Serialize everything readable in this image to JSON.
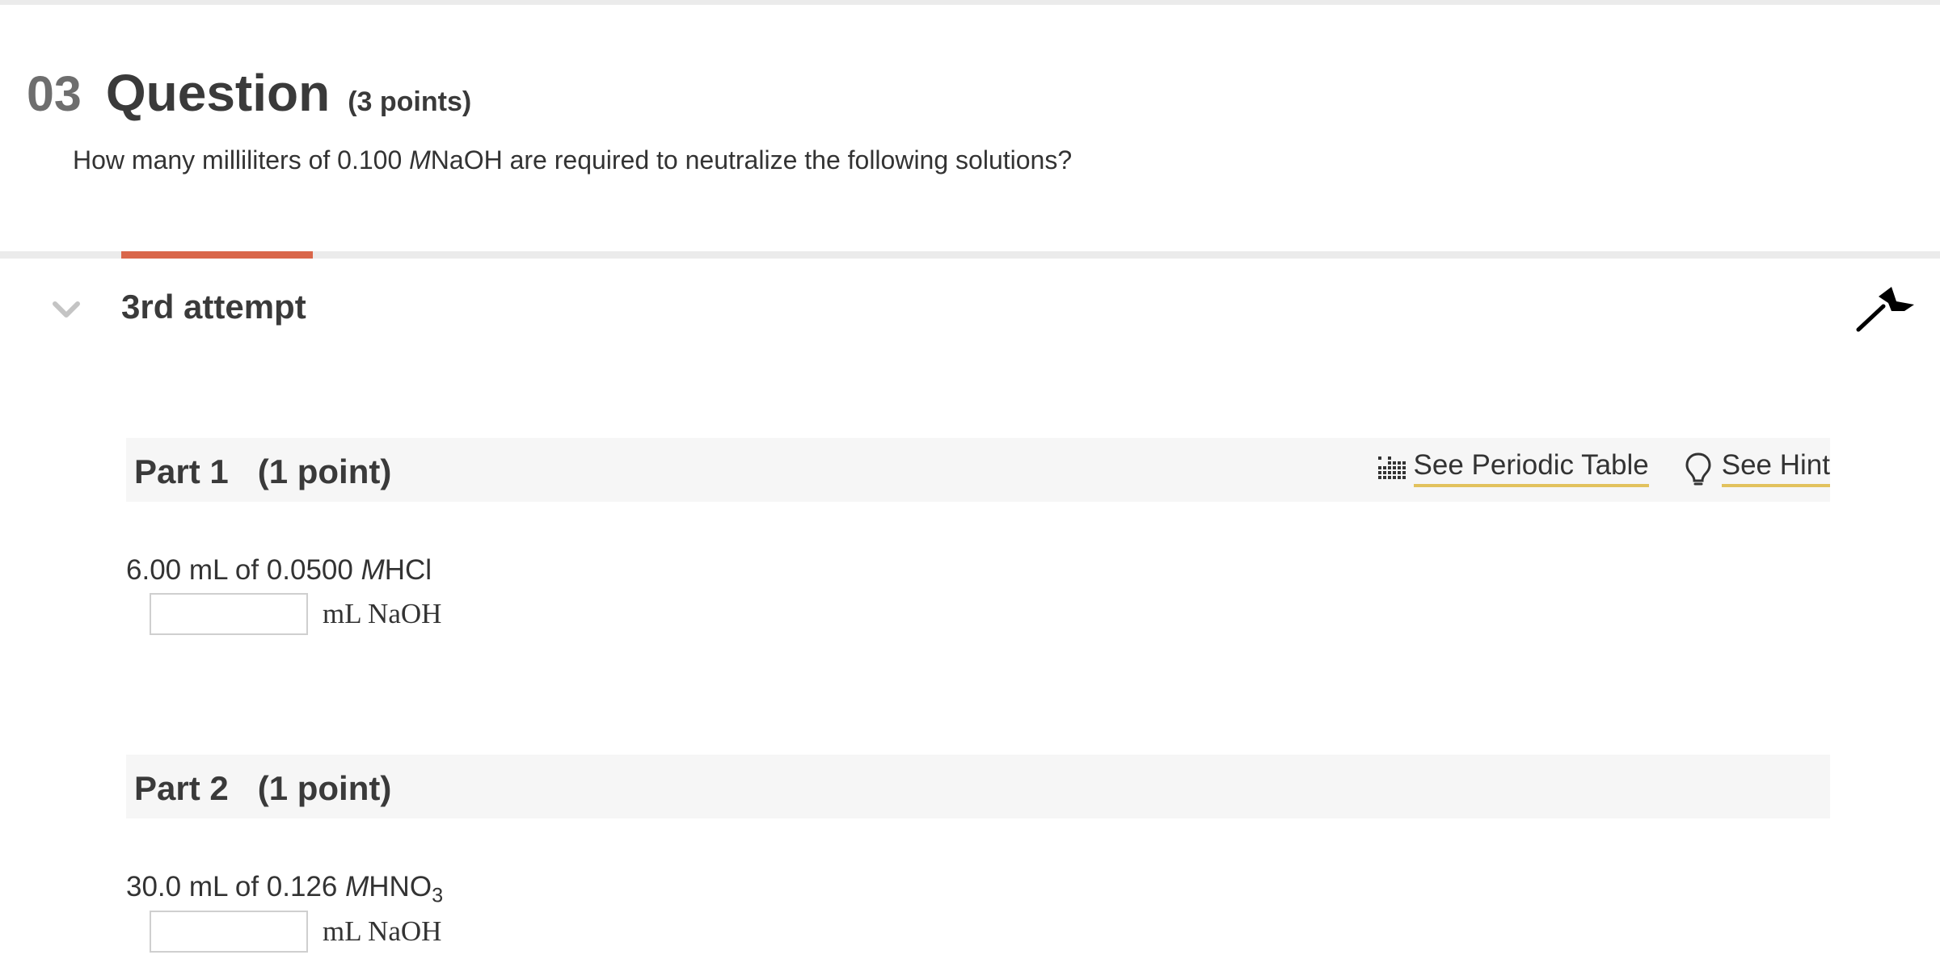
{
  "question": {
    "number": "03",
    "word": "Question",
    "points": "(3 points)",
    "prompt": {
      "before": "How many milliliters of 0.100 ",
      "italic": "M",
      "after": "NaOH are required to neutralize the following solutions?"
    }
  },
  "attempt": {
    "title": "3rd attempt"
  },
  "tools": {
    "periodic_table": "See Periodic Table",
    "hint": "See Hint"
  },
  "parts": [
    {
      "title": "Part 1",
      "points": "(1 point)",
      "prompt_before": "6.00 mL of 0.0500 ",
      "prompt_italic": "M",
      "prompt_after": "HCl",
      "answer_value": "",
      "unit": "mL NaOH"
    },
    {
      "title": "Part 2",
      "points": "(1 point)",
      "prompt_before": "30.0 mL of 0.126 ",
      "prompt_italic": "M",
      "prompt_after": "HNO",
      "prompt_sub": "3",
      "answer_value": "",
      "unit": "mL NaOH"
    }
  ],
  "colors": {
    "accent": "#d9664a",
    "link_underline": "#e2c25d",
    "part_bar": "#f6f6f6"
  }
}
